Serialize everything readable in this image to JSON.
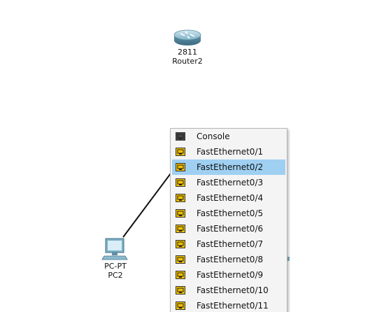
{
  "devices": {
    "router": {
      "model": "2811",
      "name": "Router2"
    },
    "pc": {
      "model": "PC-PT",
      "name": "PC2"
    }
  },
  "port_menu": {
    "items": [
      {
        "label": "Console",
        "type": "console"
      },
      {
        "label": "FastEthernet0/1",
        "type": "ethernet"
      },
      {
        "label": "FastEthernet0/2",
        "type": "ethernet",
        "selected": true
      },
      {
        "label": "FastEthernet0/3",
        "type": "ethernet"
      },
      {
        "label": "FastEthernet0/4",
        "type": "ethernet"
      },
      {
        "label": "FastEthernet0/5",
        "type": "ethernet"
      },
      {
        "label": "FastEthernet0/6",
        "type": "ethernet"
      },
      {
        "label": "FastEthernet0/7",
        "type": "ethernet"
      },
      {
        "label": "FastEthernet0/8",
        "type": "ethernet"
      },
      {
        "label": "FastEthernet0/9",
        "type": "ethernet"
      },
      {
        "label": "FastEthernet0/10",
        "type": "ethernet"
      },
      {
        "label": "FastEthernet0/11",
        "type": "ethernet"
      }
    ]
  },
  "colors": {
    "selection": "#9fd0f2",
    "ethernet_port": "#f2c200",
    "console_port": "#444444",
    "cable": "#111111"
  }
}
